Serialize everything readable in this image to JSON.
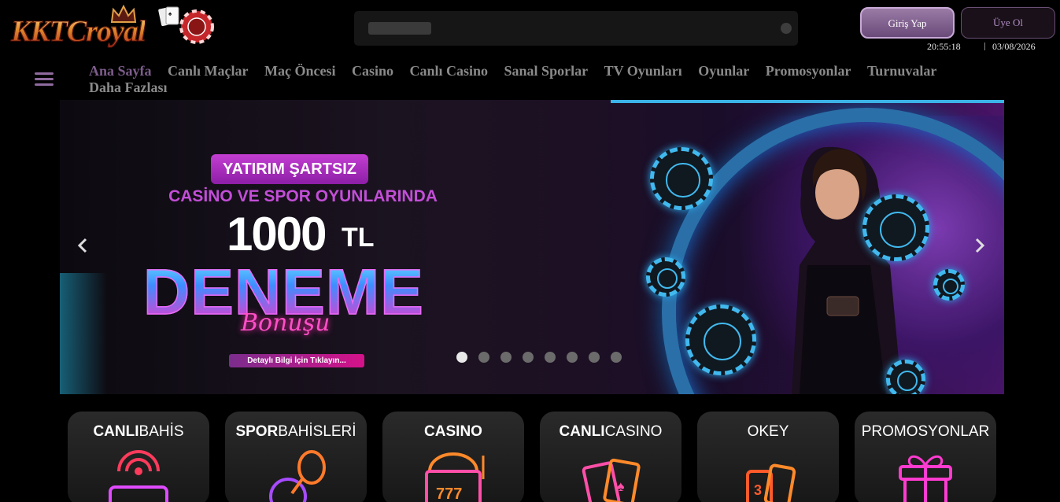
{
  "brand": {
    "logo_text": "KKTCroyal"
  },
  "header": {
    "login_label": "Giriş Yap",
    "register_label": "Üye Ol",
    "time": "20:55:18",
    "date": "03/08/2026"
  },
  "nav": {
    "items": [
      {
        "label": "Ana Sayfa",
        "active": true
      },
      {
        "label": "Canlı Maçlar"
      },
      {
        "label": "Maç Öncesi"
      },
      {
        "label": "Casino"
      },
      {
        "label": "Canlı Casino"
      },
      {
        "label": "Sanal Sporlar"
      },
      {
        "label": "TV Oyunları"
      },
      {
        "label": "Oyunlar"
      },
      {
        "label": "Promosyonlar"
      },
      {
        "label": "Turnuvalar"
      },
      {
        "label": "Daha Fazlası"
      }
    ]
  },
  "banner": {
    "badge": "YATIRIM ŞARTSIZ",
    "subtitle": "CASİNO VE SPOR OYUNLARINDA",
    "amount": "1000",
    "unit": "TL",
    "headline": "DENEME",
    "script": "Bonuşu",
    "cta": "Detaylı Bilgi İçin Tıklayın...",
    "slide_count": 8,
    "active_slide": 1
  },
  "categories": [
    {
      "bold": "CANLI",
      "light": "BAHİS",
      "icon": "live-broadcast-icon"
    },
    {
      "bold": "SPOR",
      "light": "BAHİSLERİ",
      "icon": "sports-ball-racket-icon"
    },
    {
      "bold": "CASINO",
      "light": "",
      "icon": "slot-machine-icon"
    },
    {
      "bold": "CANLI",
      "light": "CASINO",
      "icon": "playing-cards-icon"
    },
    {
      "bold": "",
      "light": "OKEY",
      "icon": "okey-tiles-icon"
    },
    {
      "bold": "",
      "light": "PROMOSYONLAR",
      "icon": "gift-box-icon"
    }
  ],
  "colors": {
    "accent": "#7d5d8c",
    "login_bg": "#6a4a79",
    "chip_blue": "#41b9ee",
    "neon_pink": "#ff2bb0"
  }
}
